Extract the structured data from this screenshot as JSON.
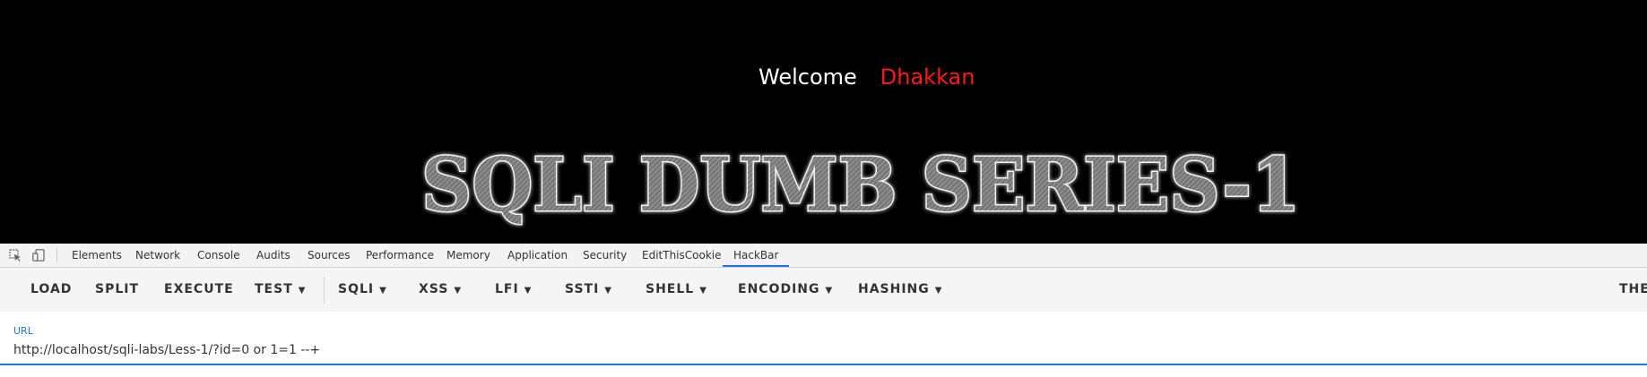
{
  "page": {
    "welcome_text": "Welcome",
    "user_name": "Dhakkan",
    "banner_title": "SQLI DUMB SERIES-1",
    "background_color": "#000000",
    "welcome_color": "#ffffff",
    "name_color": "#ff1a1a"
  },
  "devtools": {
    "icons": [
      "inspect-element-icon",
      "device-toolbar-icon"
    ],
    "tabs": [
      {
        "label": "Elements",
        "active": false
      },
      {
        "label": "Network",
        "active": false
      },
      {
        "label": "Console",
        "active": false
      },
      {
        "label": "Audits",
        "active": false
      },
      {
        "label": "Sources",
        "active": false
      },
      {
        "label": "Performance",
        "active": false
      },
      {
        "label": "Memory",
        "active": false
      },
      {
        "label": "Application",
        "active": false
      },
      {
        "label": "Security",
        "active": false
      },
      {
        "label": "EditThisCookie",
        "active": false
      },
      {
        "label": "HackBar",
        "active": true
      }
    ],
    "active_tab_color": "#1a73e8"
  },
  "hackbar": {
    "buttons": [
      {
        "label": "LOAD",
        "dropdown": false
      },
      {
        "label": "SPLIT",
        "dropdown": false
      },
      {
        "label": "EXECUTE",
        "dropdown": false
      },
      {
        "label": "TEST",
        "dropdown": true
      },
      {
        "label": "SQLI",
        "dropdown": true
      },
      {
        "label": "XSS",
        "dropdown": true
      },
      {
        "label": "LFI",
        "dropdown": true
      },
      {
        "label": "SSTI",
        "dropdown": true
      },
      {
        "label": "SHELL",
        "dropdown": true
      },
      {
        "label": "ENCODING",
        "dropdown": true
      },
      {
        "label": "HASHING",
        "dropdown": true
      },
      {
        "label": "THE",
        "dropdown": false
      }
    ],
    "url_label": "URL",
    "url_value": "http://localhost/sqli-labs/Less-1/?id=0 or 1=1 --+",
    "accent_color": "#1a73e8"
  }
}
